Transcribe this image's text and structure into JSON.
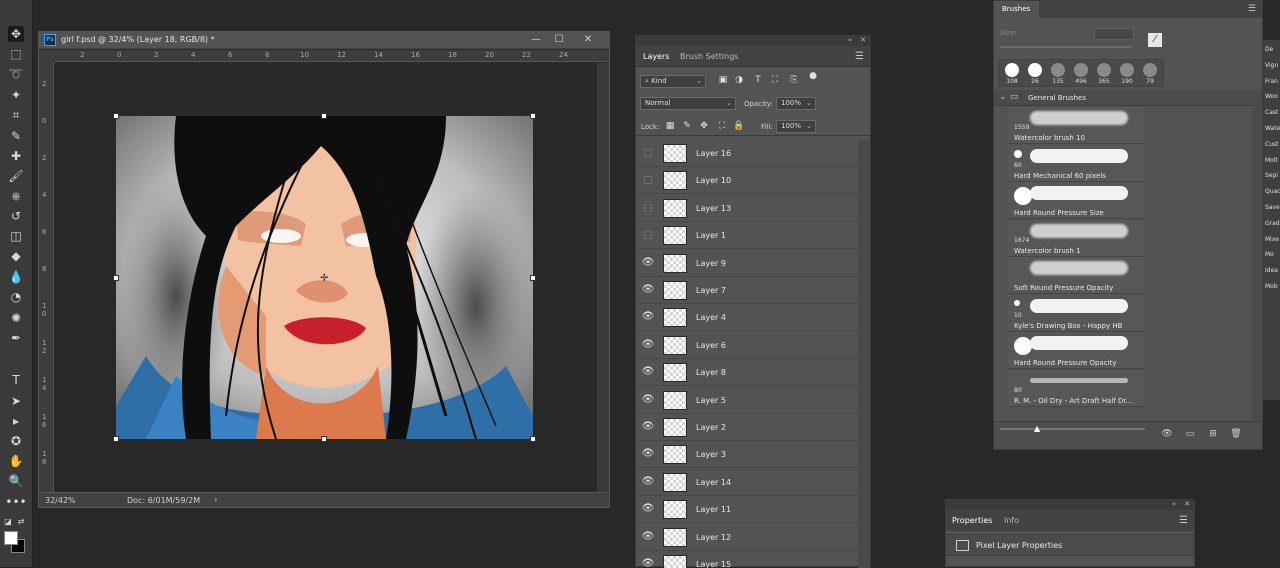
{
  "document": {
    "title": "girl f.psd @ 32/4% (Layer 18, RGB/8) *",
    "badge": "Ps",
    "zoom": "32/42%",
    "doc_info": "Doc: 6/01M/59/2M",
    "ruler_h": [
      "2",
      "0",
      "2",
      "4",
      "6",
      "8",
      "10",
      "12",
      "14",
      "16",
      "18",
      "20",
      "22",
      "24"
    ],
    "ruler_v": [
      "2",
      "0",
      "2",
      "4",
      "6",
      "8",
      "1 0",
      "1 2",
      "1 4",
      "1 6",
      "1 8"
    ]
  },
  "layers_panel": {
    "tabs": [
      "Layers",
      "Brush Settings"
    ],
    "filter": "Kind",
    "blend_mode": "Normal",
    "opacity_label": "Opacity:",
    "opacity": "100%",
    "lock_label": "Lock:",
    "fill_label": "Fill:",
    "fill": "100%",
    "layers": [
      {
        "name": "Layer 16",
        "visible": false
      },
      {
        "name": "Layer 10",
        "visible": false
      },
      {
        "name": "Layer 13",
        "visible": false
      },
      {
        "name": "Layer 1",
        "visible": false
      },
      {
        "name": "Layer 9",
        "visible": true
      },
      {
        "name": "Layer 7",
        "visible": true
      },
      {
        "name": "Layer 4",
        "visible": true
      },
      {
        "name": "Layer 6",
        "visible": true
      },
      {
        "name": "Layer 8",
        "visible": true
      },
      {
        "name": "Layer 5",
        "visible": true
      },
      {
        "name": "Layer 2",
        "visible": true
      },
      {
        "name": "Layer 3",
        "visible": true
      },
      {
        "name": "Layer 14",
        "visible": true
      },
      {
        "name": "Layer 11",
        "visible": true
      },
      {
        "name": "Layer 12",
        "visible": true
      },
      {
        "name": "Layer 15",
        "visible": true
      }
    ]
  },
  "brushes_panel": {
    "tab": "Brushes",
    "size_label": "Size:",
    "presets": [
      "108",
      "26",
      "135",
      "496",
      "365",
      "190",
      "79"
    ],
    "group": "General Brushes",
    "brushes": [
      {
        "num": "1559",
        "name": "Watercolor brush 10"
      },
      {
        "num": "60",
        "name": "Hard Mechanical 60 pixels"
      },
      {
        "num": "",
        "name": "Hard Round Pressure Size"
      },
      {
        "num": "1674",
        "name": "Watercolor brush 1"
      },
      {
        "num": "",
        "name": "Soft Round Pressure Opacity"
      },
      {
        "num": "10",
        "name": "Kyle's Drawing Box - Happy HB"
      },
      {
        "num": "",
        "name": "Hard Round Pressure Opacity"
      },
      {
        "num": "80",
        "name": "R. M. - Oil Dry - Art Draft Half Dr..."
      }
    ]
  },
  "right_column": [
    "De",
    "Vign",
    "Fran",
    "Woo",
    "Cast",
    "Wate",
    "Cust",
    "Molt",
    "Sepi",
    "Quac",
    "Save",
    "Grad",
    "Mixe",
    "Mo",
    "Idea",
    "Mob"
  ],
  "properties_panel": {
    "tabs": [
      "Properties",
      "Info"
    ],
    "title": "Pixel Layer Properties"
  },
  "colors": {
    "foreground": "#ffffff",
    "background": "#000000"
  }
}
